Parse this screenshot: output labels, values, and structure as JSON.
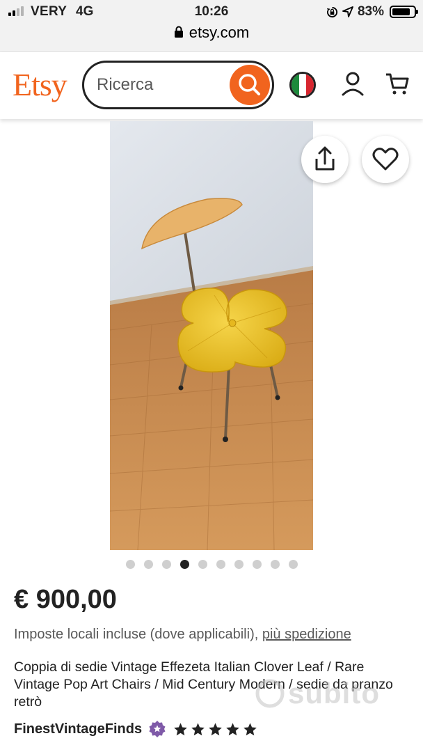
{
  "status_bar": {
    "carrier": "VERY",
    "network": "4G",
    "time": "10:26",
    "battery": "83%",
    "battery_level": 0.83
  },
  "url_bar": {
    "domain": "etsy.com"
  },
  "header": {
    "logo": "Etsy",
    "search_placeholder": "Ricerca",
    "accent": "#f1641e"
  },
  "gallery": {
    "image_count": 10,
    "active_index": 3
  },
  "product": {
    "price": "€ 900,00",
    "tax_note": "Imposte locali incluse (dove applicabili), ",
    "shipping_link": "più spedizione",
    "title": "Coppia di sedie Vintage Effezeta Italian Clover Leaf / Rare Vintage Pop Art Chairs / Mid Century Modern / sedie da pranzo retrò",
    "seller": "FinestVintageFinds",
    "rating": 5
  },
  "watermark": "subito"
}
